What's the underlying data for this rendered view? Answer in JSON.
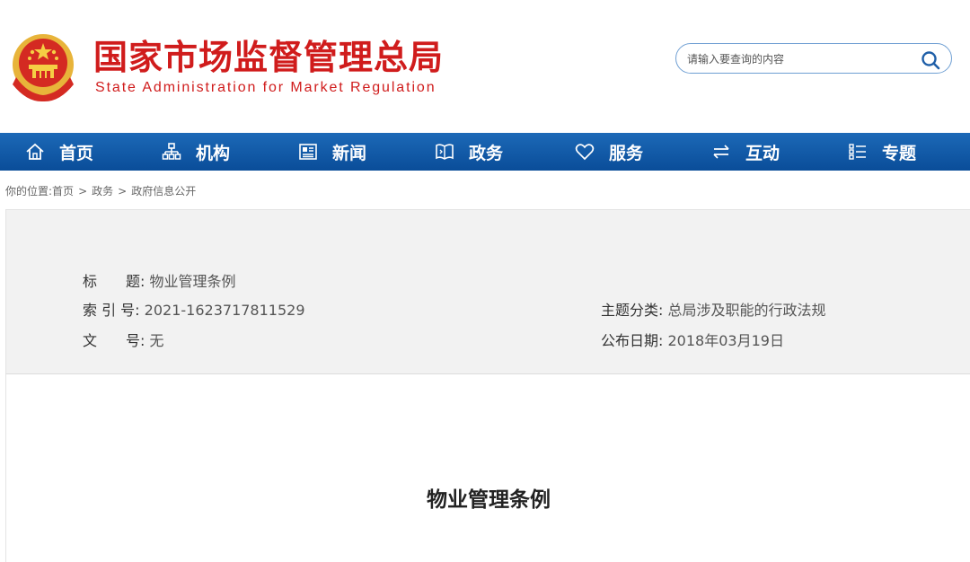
{
  "header": {
    "title": "国家市场监督管理总局",
    "subtitle": "State Administration for Market Regulation",
    "logo_icon": "national-emblem-icon"
  },
  "search": {
    "placeholder": "请输入要查询的内容",
    "value": "",
    "icon": "search-icon"
  },
  "nav": {
    "items": [
      {
        "label": "首页",
        "icon": "home-icon"
      },
      {
        "label": "机构",
        "icon": "org-chart-icon"
      },
      {
        "label": "新闻",
        "icon": "newspaper-icon"
      },
      {
        "label": "政务",
        "icon": "book-icon"
      },
      {
        "label": "服务",
        "icon": "heart-icon"
      },
      {
        "label": "互动",
        "icon": "exchange-arrows-icon"
      },
      {
        "label": "专题",
        "icon": "list-icon"
      }
    ]
  },
  "breadcrumb": {
    "prefix": "你的位置:",
    "items": [
      "首页",
      "政务",
      "政府信息公开"
    ],
    "separator": ">"
  },
  "meta": {
    "title_label": "标　　题:",
    "title_value": "物业管理条例",
    "index_label": "索 引 号:",
    "index_value": "2021-1623717811529",
    "doc_no_label": "文　　号:",
    "doc_no_value": "无",
    "category_label": "主题分类:",
    "category_value": "总局涉及职能的行政法规",
    "date_label": "公布日期:",
    "date_value": "2018年03月19日"
  },
  "document": {
    "title": "物业管理条例"
  },
  "colors": {
    "brand_red": "#d01c1c",
    "nav_blue": "#0a4d99",
    "search_border": "#6f9fd3"
  }
}
